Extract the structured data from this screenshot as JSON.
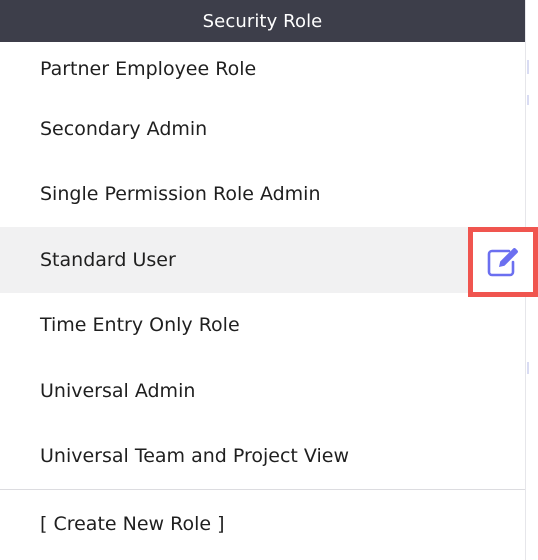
{
  "header": {
    "title": "Security Role"
  },
  "roles": [
    {
      "label": "Partner Employee Role"
    },
    {
      "label": "Secondary Admin"
    },
    {
      "label": "Single Permission Role Admin"
    },
    {
      "label": "Standard User"
    },
    {
      "label": "Time Entry Only Role"
    },
    {
      "label": "Universal Admin"
    },
    {
      "label": "Universal Team and Project View"
    }
  ],
  "selected_role": "Standard User",
  "create_label": "[ Create New Role ]",
  "icons": {
    "edit": "edit-icon"
  },
  "colors": {
    "header_bg": "#3d3e4a",
    "selected_bg": "#f1f1f2",
    "highlight_border": "#f0554f",
    "edit_icon": "#6b6ff0"
  }
}
